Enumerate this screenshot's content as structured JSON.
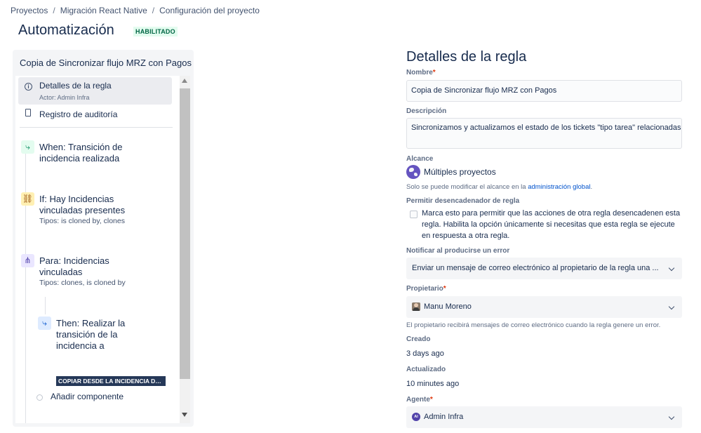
{
  "breadcrumb": [
    "Proyectos",
    "Migración React Native",
    "Configuración del proyecto"
  ],
  "page": {
    "title": "Automatización",
    "status": "HABILITADO"
  },
  "left_panel": {
    "rule_name": "Copia de Sincronizar flujo MRZ con Pagos",
    "details": {
      "label": "Detalles de la regla",
      "actor": "Actor: Admin Infra"
    },
    "audit": {
      "label": "Registro de auditoría"
    },
    "components": [
      {
        "type": "trigger",
        "icon": "transition-icon",
        "title": "When: Transición de incidencia realizada",
        "subtitle": ""
      },
      {
        "type": "condition",
        "icon": "link-icon",
        "title": "If: Hay Incidencias vinculadas presentes",
        "subtitle": "Tipos: is cloned by, clones"
      },
      {
        "type": "branch",
        "icon": "hierarchy-icon",
        "title": "Para: Incidencias vinculadas",
        "subtitle": "Tipos: clones, is cloned by"
      },
      {
        "type": "action",
        "icon": "transition-icon",
        "title": "Then: Realizar la transición de la incidencia a",
        "badge": "COPIAR DESDE LA INCIDENCIA DE..."
      }
    ],
    "add_component": "Añadir componente"
  },
  "details": {
    "title": "Detalles de la regla",
    "name": {
      "label": "Nombre",
      "value": "Copia de Sincronizar flujo MRZ con Pagos"
    },
    "description": {
      "label": "Descripción",
      "value": "Sincronizamos y actualizamos el estado de los tickets \"tipo tarea\" relacionadas"
    },
    "scope": {
      "label": "Alcance",
      "value": "Múltiples proyectos",
      "helper_prefix": "Solo se puede modificar el alcance en la",
      "helper_link": "administración global",
      "helper_suffix": "."
    },
    "allow_trigger": {
      "label": "Permitir desencadenador de regla",
      "text": "Marca esto para permitir que las acciones de otra regla desencadenen esta regla. Habilita la opción únicamente si necesitas que esta regla se ejecute en respuesta a otra regla."
    },
    "notify": {
      "label": "Notificar al producirse un error",
      "value": "Enviar un mensaje de correo electrónico al propietario de la regla una ..."
    },
    "owner": {
      "label": "Propietario",
      "value": "Manu Moreno",
      "helper": "El propietario recibirá mensajes de correo electrónico cuando la regla genere un error."
    },
    "created": {
      "label": "Creado",
      "value": "3 days ago"
    },
    "updated": {
      "label": "Actualizado",
      "value": "10 minutes ago"
    },
    "agent": {
      "label": "Agente",
      "value": "Admin Infra",
      "avatar_initials": "AI"
    },
    "required_mark": "*"
  }
}
